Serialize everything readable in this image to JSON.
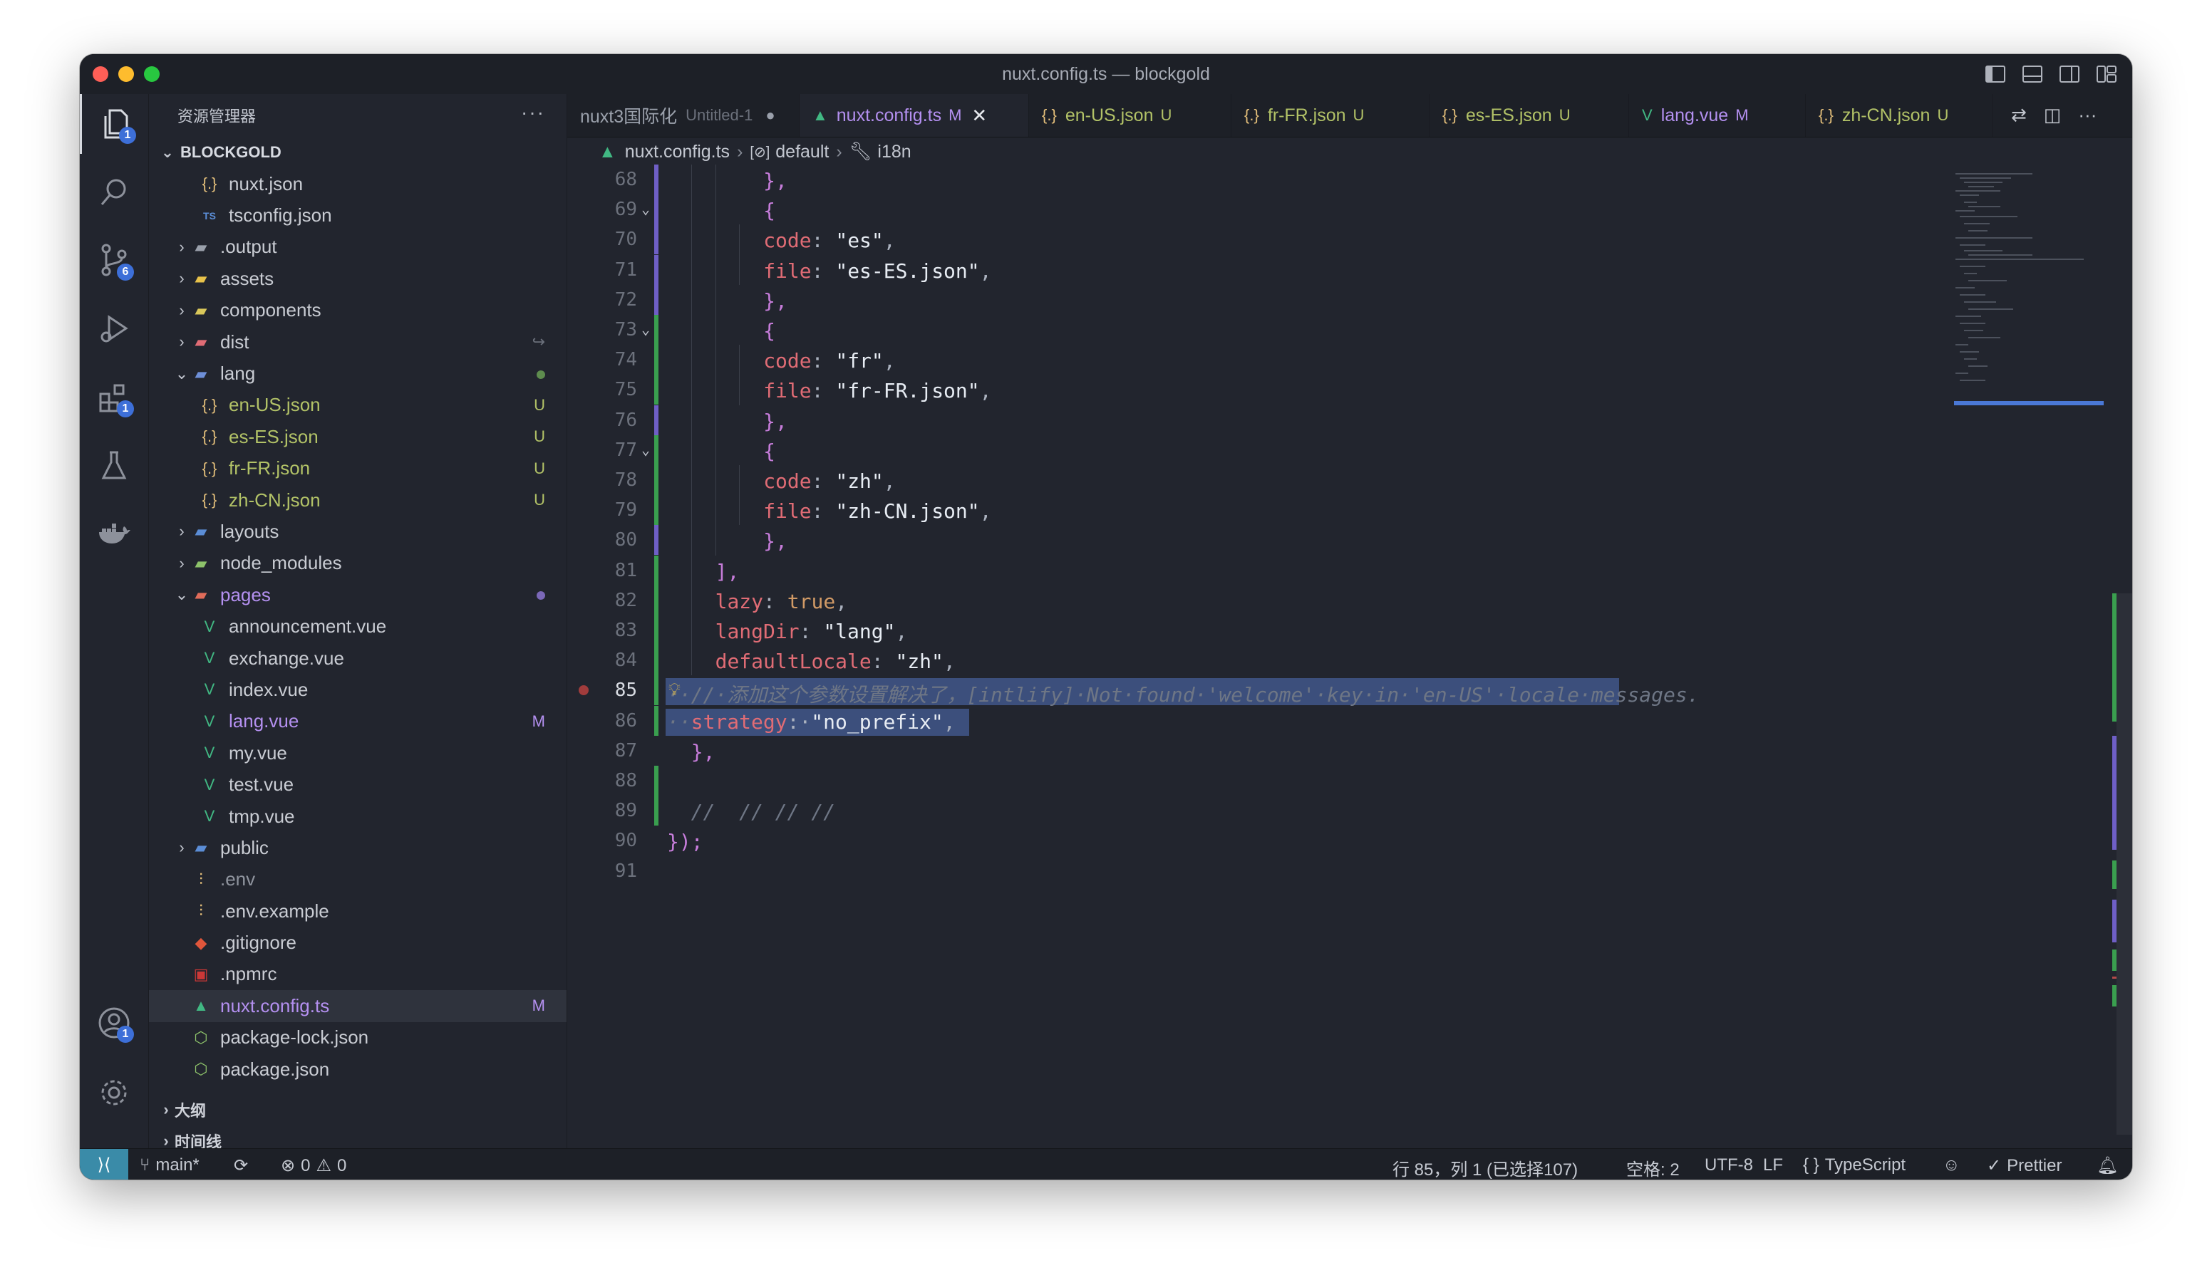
{
  "window": {
    "title": "nuxt.config.ts — blockgold"
  },
  "activity_bar": {
    "explorer_badge": "1",
    "scm_badge": "6",
    "extensions_badge": "1",
    "accounts_badge": "1"
  },
  "sidebar": {
    "header": "资源管理器",
    "more": "···",
    "root": "BLOCKGOLD",
    "tree": [
      {
        "label": "nuxt.json",
        "indent": 2,
        "icon": "{.}",
        "icon_color": "#e5c07b",
        "color": "#c9ccd3"
      },
      {
        "label": "tsconfig.json",
        "indent": 2,
        "icon": "TS",
        "icon_color": "#5b8dd6",
        "color": "#c9ccd3"
      },
      {
        "label": ".output",
        "indent": 1,
        "chev": "›",
        "icon": "▰",
        "icon_color": "#9aa0ab",
        "color": "#c9ccd3"
      },
      {
        "label": "assets",
        "indent": 1,
        "chev": "›",
        "icon": "▰",
        "icon_color": "#e8c24a",
        "color": "#c9ccd3"
      },
      {
        "label": "components",
        "indent": 1,
        "chev": "›",
        "icon": "▰",
        "icon_color": "#d9c75a",
        "color": "#c9ccd3"
      },
      {
        "label": "dist",
        "indent": 1,
        "chev": "›",
        "icon": "▰",
        "icon_color": "#e06c75",
        "color": "#c9ccd3",
        "status": "↪",
        "status_color": "#6b707b"
      },
      {
        "label": "lang",
        "indent": 1,
        "chev": "⌄",
        "icon": "▰",
        "icon_color": "#6e8fd8",
        "color": "#c9ccd3",
        "dot": "#5e8c4e"
      },
      {
        "label": "en-US.json",
        "indent": 2,
        "icon": "{.}",
        "icon_color": "#e5c07b",
        "color": "#b2c267",
        "status": "U",
        "status_color": "#b2c267"
      },
      {
        "label": "es-ES.json",
        "indent": 2,
        "icon": "{.}",
        "icon_color": "#e5c07b",
        "color": "#b2c267",
        "status": "U",
        "status_color": "#b2c267"
      },
      {
        "label": "fr-FR.json",
        "indent": 2,
        "icon": "{.}",
        "icon_color": "#e5c07b",
        "color": "#b2c267",
        "status": "U",
        "status_color": "#b2c267"
      },
      {
        "label": "zh-CN.json",
        "indent": 2,
        "icon": "{.}",
        "icon_color": "#e5c07b",
        "color": "#b2c267",
        "status": "U",
        "status_color": "#b2c267"
      },
      {
        "label": "layouts",
        "indent": 1,
        "chev": "›",
        "icon": "▰",
        "icon_color": "#5b8dd6",
        "color": "#c9ccd3"
      },
      {
        "label": "node_modules",
        "indent": 1,
        "chev": "›",
        "icon": "▰",
        "icon_color": "#8dc26a",
        "color": "#c9ccd3"
      },
      {
        "label": "pages",
        "indent": 1,
        "chev": "⌄",
        "icon": "▰",
        "icon_color": "#e06c5a",
        "color": "#b490f0",
        "dot": "#7b68b8"
      },
      {
        "label": "announcement.vue",
        "indent": 2,
        "icon": "V",
        "icon_color": "#41b883",
        "color": "#c9ccd3"
      },
      {
        "label": "exchange.vue",
        "indent": 2,
        "icon": "V",
        "icon_color": "#41b883",
        "color": "#c9ccd3"
      },
      {
        "label": "index.vue",
        "indent": 2,
        "icon": "V",
        "icon_color": "#41b883",
        "color": "#c9ccd3"
      },
      {
        "label": "lang.vue",
        "indent": 2,
        "icon": "V",
        "icon_color": "#41b883",
        "color": "#b490f0",
        "status": "M",
        "status_color": "#b490f0"
      },
      {
        "label": "my.vue",
        "indent": 2,
        "icon": "V",
        "icon_color": "#41b883",
        "color": "#c9ccd3"
      },
      {
        "label": "test.vue",
        "indent": 2,
        "icon": "V",
        "icon_color": "#41b883",
        "color": "#c9ccd3"
      },
      {
        "label": "tmp.vue",
        "indent": 2,
        "icon": "V",
        "icon_color": "#41b883",
        "color": "#c9ccd3"
      },
      {
        "label": "public",
        "indent": 1,
        "chev": "›",
        "icon": "▰",
        "icon_color": "#5b8dd6",
        "color": "#c9ccd3"
      },
      {
        "label": ".env",
        "indent": 1,
        "icon": "⫶",
        "icon_color": "#e5c07b",
        "color": "#8f949e"
      },
      {
        "label": ".env.example",
        "indent": 1,
        "icon": "⫶",
        "icon_color": "#e5c07b",
        "color": "#c9ccd3"
      },
      {
        "label": ".gitignore",
        "indent": 1,
        "icon": "◆",
        "icon_color": "#e0563b",
        "color": "#c9ccd3"
      },
      {
        "label": ".npmrc",
        "indent": 1,
        "icon": "▣",
        "icon_color": "#cb3837",
        "color": "#c9ccd3"
      },
      {
        "label": "nuxt.config.ts",
        "indent": 1,
        "icon": "▲",
        "icon_color": "#41b883",
        "color": "#b490f0",
        "status": "M",
        "status_color": "#b490f0",
        "active": true
      },
      {
        "label": "package-lock.json",
        "indent": 1,
        "icon": "⬡",
        "icon_color": "#8dc26a",
        "color": "#c9ccd3"
      },
      {
        "label": "package.json",
        "indent": 1,
        "icon": "⬡",
        "icon_color": "#8dc26a",
        "color": "#c9ccd3"
      }
    ],
    "outline_label": "大纲",
    "timeline_label": "时间线"
  },
  "tabs": [
    {
      "label": "nuxt3国际化",
      "extra": "Untitled-1",
      "status": "●",
      "icon": "",
      "label_color": "#9aa0ab",
      "status_color": "#9aa0ab"
    },
    {
      "label": "nuxt.config.ts",
      "status": "M",
      "icon": "▲",
      "icon_color": "#41b883",
      "label_color": "#b490f0",
      "status_color": "#b490f0",
      "active": true
    },
    {
      "label": "en-US.json",
      "status": "U",
      "icon": "{.}",
      "icon_color": "#e5c07b",
      "label_color": "#b2c267",
      "status_color": "#b2c267"
    },
    {
      "label": "fr-FR.json",
      "status": "U",
      "icon": "{.}",
      "icon_color": "#e5c07b",
      "label_color": "#b2c267",
      "status_color": "#b2c267"
    },
    {
      "label": "es-ES.json",
      "status": "U",
      "icon": "{.}",
      "icon_color": "#e5c07b",
      "label_color": "#b2c267",
      "status_color": "#b2c267"
    },
    {
      "label": "lang.vue",
      "status": "M",
      "icon": "V",
      "icon_color": "#41b883",
      "label_color": "#b490f0",
      "status_color": "#b490f0"
    },
    {
      "label": "zh-CN.json",
      "status": "U",
      "icon": "{.}",
      "icon_color": "#e5c07b",
      "label_color": "#b2c267",
      "status_color": "#b2c267"
    }
  ],
  "breadcrumb": {
    "file": "nuxt.config.ts",
    "symbol1": "default",
    "symbol2": "i18n"
  },
  "editor": {
    "current_line": 85,
    "lines": [
      {
        "n": "68",
        "tokens": [
          [
            "k-p",
            "  },"
          ]
        ],
        "indent": 3
      },
      {
        "n": "69",
        "tokens": [
          [
            "k-p",
            "  {"
          ]
        ],
        "indent": 3,
        "fold": true
      },
      {
        "n": "70",
        "tokens": [
          [
            "k-prop",
            "code"
          ],
          [
            "k-punc",
            ": "
          ],
          [
            "k-str",
            "\"es\""
          ],
          [
            "k-punc",
            ","
          ]
        ],
        "indent": 4
      },
      {
        "n": "71",
        "tokens": [
          [
            "k-prop",
            "file"
          ],
          [
            "k-punc",
            ": "
          ],
          [
            "k-str",
            "\"es-ES.json\""
          ],
          [
            "k-punc",
            ","
          ]
        ],
        "indent": 4
      },
      {
        "n": "72",
        "tokens": [
          [
            "k-p",
            "  },"
          ]
        ],
        "indent": 3
      },
      {
        "n": "73",
        "tokens": [
          [
            "k-p",
            "  {"
          ]
        ],
        "indent": 3,
        "fold": true
      },
      {
        "n": "74",
        "tokens": [
          [
            "k-prop",
            "code"
          ],
          [
            "k-punc",
            ": "
          ],
          [
            "k-str",
            "\"fr\""
          ],
          [
            "k-punc",
            ","
          ]
        ],
        "indent": 4
      },
      {
        "n": "75",
        "tokens": [
          [
            "k-prop",
            "file"
          ],
          [
            "k-punc",
            ": "
          ],
          [
            "k-str",
            "\"fr-FR.json\""
          ],
          [
            "k-punc",
            ","
          ]
        ],
        "indent": 4
      },
      {
        "n": "76",
        "tokens": [
          [
            "k-p",
            "  },"
          ]
        ],
        "indent": 3
      },
      {
        "n": "77",
        "tokens": [
          [
            "k-p",
            "  {"
          ]
        ],
        "indent": 3,
        "fold": true
      },
      {
        "n": "78",
        "tokens": [
          [
            "k-prop",
            "code"
          ],
          [
            "k-punc",
            ": "
          ],
          [
            "k-str",
            "\"zh\""
          ],
          [
            "k-punc",
            ","
          ]
        ],
        "indent": 4
      },
      {
        "n": "79",
        "tokens": [
          [
            "k-prop",
            "file"
          ],
          [
            "k-punc",
            ": "
          ],
          [
            "k-str",
            "\"zh-CN.json\""
          ],
          [
            "k-punc",
            ","
          ]
        ],
        "indent": 4
      },
      {
        "n": "80",
        "tokens": [
          [
            "k-p",
            "  },"
          ]
        ],
        "indent": 3
      },
      {
        "n": "81",
        "tokens": [
          [
            "k-p",
            "],"
          ]
        ],
        "indent": 2
      },
      {
        "n": "82",
        "tokens": [
          [
            "k-prop",
            "lazy"
          ],
          [
            "k-punc",
            ": "
          ],
          [
            "k-bool",
            "true"
          ],
          [
            "k-punc",
            ","
          ]
        ],
        "indent": 2
      },
      {
        "n": "83",
        "tokens": [
          [
            "k-prop",
            "langDir"
          ],
          [
            "k-punc",
            ": "
          ],
          [
            "k-str",
            "\"lang\""
          ],
          [
            "k-punc",
            ","
          ]
        ],
        "indent": 2
      },
      {
        "n": "84",
        "tokens": [
          [
            "k-prop",
            "defaultLocale"
          ],
          [
            "k-punc",
            ": "
          ],
          [
            "k-str",
            "\"zh\""
          ],
          [
            "k-punc",
            ","
          ]
        ],
        "indent": 2
      },
      {
        "n": "85",
        "tokens": [
          [
            "k-com",
            "··//·添加这个参数设置解决了，[intlify]·Not·found·'welcome'·key·in·'en-US'·locale·messages."
          ]
        ],
        "indent": 0,
        "selected": true,
        "bulb": true,
        "bp": true
      },
      {
        "n": "86",
        "tokens": [
          [
            "k-com",
            "··"
          ],
          [
            "k-prop",
            "strategy"
          ],
          [
            "k-punc",
            ":·"
          ],
          [
            "k-str",
            "\"no_prefix\""
          ],
          [
            "k-punc",
            ","
          ]
        ],
        "indent": 0,
        "selected": true
      },
      {
        "n": "87",
        "tokens": [
          [
            "k-p",
            "},"
          ]
        ],
        "indent": 1
      },
      {
        "n": "88",
        "tokens": [],
        "indent": 0
      },
      {
        "n": "89",
        "tokens": [
          [
            "k-com",
            "//  // // //"
          ]
        ],
        "indent": 1
      },
      {
        "n": "90",
        "tokens": [
          [
            "k-p",
            "});"
          ]
        ],
        "indent": 0
      },
      {
        "n": "91",
        "tokens": [],
        "indent": 0
      }
    ]
  },
  "statusbar": {
    "branch": "main*",
    "errors": "0",
    "warnings": "0",
    "cursor": "行 85，列 1 (已选择107)",
    "spaces": "空格: 2",
    "encoding": "UTF-8",
    "eol": "LF",
    "language": "TypeScript",
    "formatter": "Prettier"
  },
  "colors": {
    "accent": "#3d6fd8",
    "remote": "#3a8ba8",
    "modified": "#b490f0",
    "untracked": "#b2c267"
  }
}
